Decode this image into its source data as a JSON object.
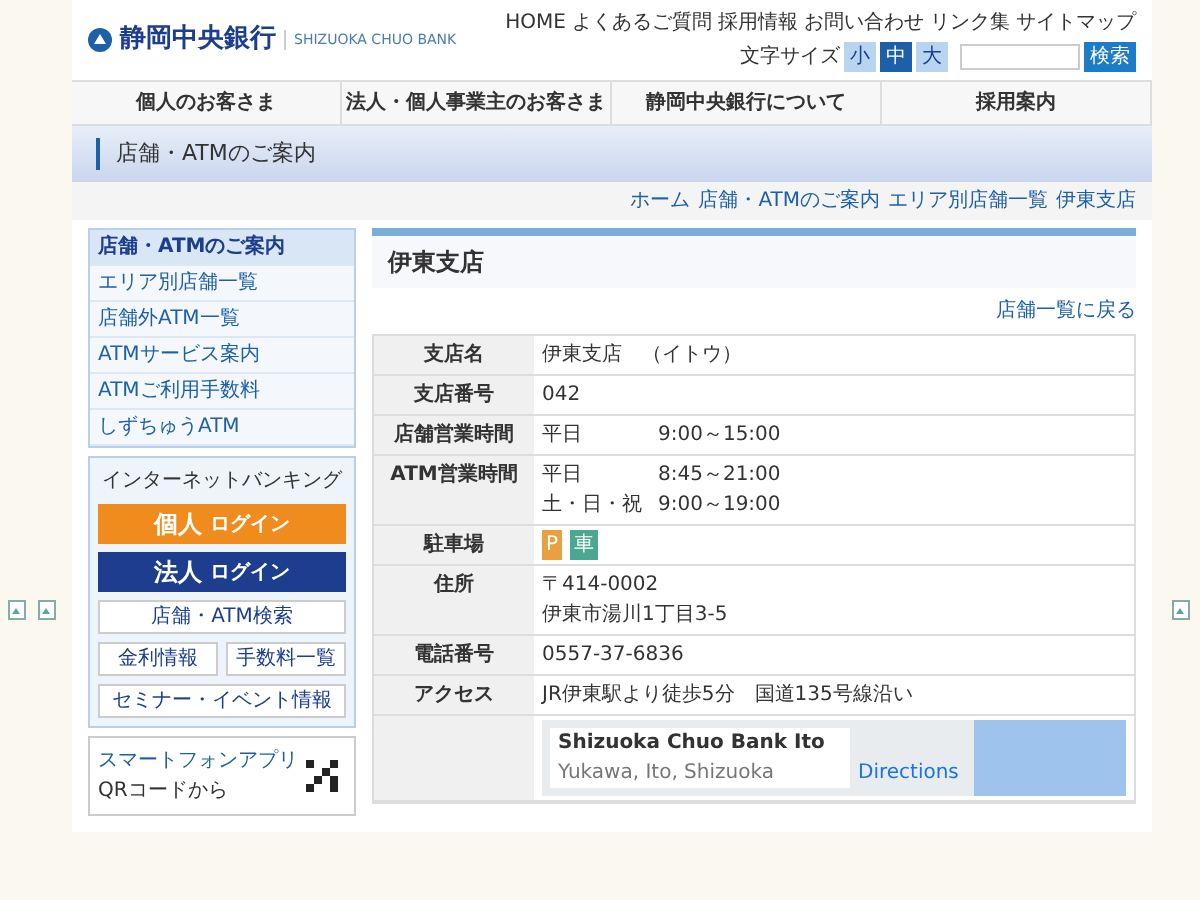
{
  "header": {
    "logo": "静岡中央銀行",
    "logo_en": "SHIZUOKA CHUO BANK",
    "top_links": [
      "HOME",
      "よくあるご質問",
      "採用情報",
      "お問い合わせ",
      "リンク集",
      "サイトマップ"
    ],
    "font_size_label": "文字サイズ",
    "font_sizes": [
      {
        "label": "小",
        "selected": false
      },
      {
        "label": "中",
        "selected": true
      },
      {
        "label": "大",
        "selected": false
      }
    ],
    "search_button": "検索"
  },
  "nav": [
    "個人のお客さま",
    "法人・個人事業主のお客さま",
    "静岡中央銀行について",
    "採用案内"
  ],
  "page_title": "店舗・ATMのご案内",
  "breadcrumb": [
    "ホーム",
    "店舗・ATMのご案内",
    "エリア別店舗一覧",
    "伊東支店"
  ],
  "sidebar": {
    "menu": [
      {
        "label": "店舗・ATMのご案内",
        "selected": true
      },
      {
        "label": "エリア別店舗一覧",
        "selected": false
      },
      {
        "label": "店舗外ATM一覧",
        "selected": false
      },
      {
        "label": "ATMサービス案内",
        "selected": false
      },
      {
        "label": "ATMご利用手数料",
        "selected": false
      },
      {
        "label": "しずちゅうATM",
        "selected": false
      }
    ],
    "banking_title": "インターネットバンキング",
    "logins": [
      {
        "label": "個人",
        "sub": "ログイン",
        "color": "#f08c1e"
      },
      {
        "label": "法人",
        "sub": "ログイン",
        "color": "#1d3d8f"
      }
    ],
    "search_link": "店舗・ATM検索",
    "small_links": [
      "金利情報",
      "手数料一覧"
    ],
    "event_link": "セミナー・イベント情報",
    "app_title": "スマートフォンアプリ",
    "app_note": "QRコードから"
  },
  "branch": {
    "title": "伊東支店",
    "back_link": "店舗一覧に戻る",
    "rows": [
      {
        "kind": "text",
        "label": "支店名",
        "lines": [
          "伊東支店　（イトウ）"
        ]
      },
      {
        "kind": "text",
        "label": "支店番号",
        "lines": [
          "042"
        ]
      },
      {
        "kind": "hours",
        "label": "店舗営業時間",
        "hours": [
          {
            "day": "平日",
            "time": "9:00～15:00"
          }
        ]
      },
      {
        "kind": "hours",
        "label": "ATM営業時間",
        "hours": [
          {
            "day": "平日",
            "time": "8:45～21:00"
          },
          {
            "day": "土・日・祝",
            "time": "9:00～19:00"
          }
        ]
      },
      {
        "kind": "badges",
        "label": "駐車場",
        "badges": [
          {
            "label": "P",
            "color": "#e8a040"
          },
          {
            "label": "車",
            "color": "#4aa890"
          }
        ]
      },
      {
        "kind": "text",
        "label": "住所",
        "lines": [
          "〒414-0002",
          "伊東市湯川1丁目3-5"
        ]
      },
      {
        "kind": "text",
        "label": "電話番号",
        "lines": [
          "0557-37-6836"
        ]
      },
      {
        "kind": "text",
        "label": "アクセス",
        "lines": [
          "JR伊東駅より徒歩5分　国道135号線沿い"
        ]
      },
      {
        "kind": "map",
        "label": "",
        "map_title": "Shizuoka Chuo Bank Ito",
        "map_sub": "Yukawa, Ito, Shizuoka",
        "map_link": "Directions"
      }
    ]
  }
}
